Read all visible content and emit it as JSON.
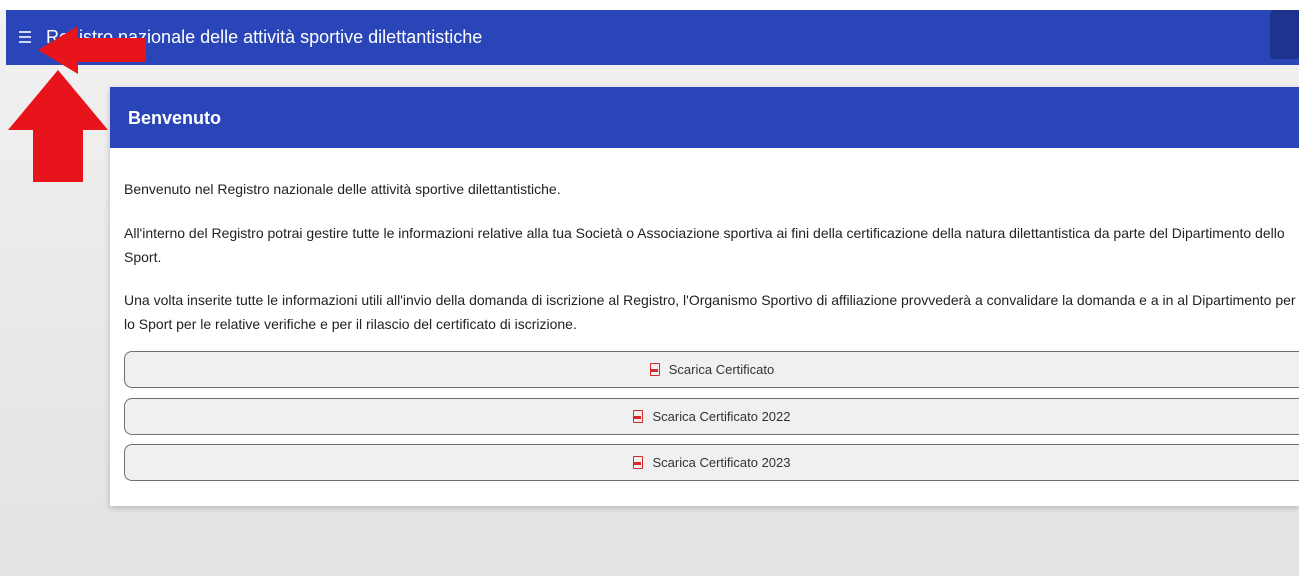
{
  "app_title": "Registro nazionale delle attività sportive dilettantistiche",
  "card": {
    "title": "Benvenuto",
    "paragraphs": [
      "Benvenuto nel Registro nazionale delle attività sportive dilettantistiche.",
      "All'interno del Registro potrai gestire tutte le informazioni relative alla tua Società o Associazione sportiva ai fini della certificazione della natura dilettantistica da parte del Dipartimento dello Sport.",
      "Una volta inserite tutte le informazioni utili all'invio della domanda di iscrizione al Registro, l'Organismo Sportivo di affiliazione provvederà a convalidare la domanda e a in al Dipartimento per lo Sport per le relative verifiche e per il rilascio del certificato di iscrizione."
    ],
    "buttons": [
      {
        "label": "Scarica Certificato",
        "icon": "pdf-icon"
      },
      {
        "label": "Scarica Certificato 2022",
        "icon": "pdf-icon"
      },
      {
        "label": "Scarica Certificato 2023",
        "icon": "pdf-icon"
      }
    ]
  },
  "colors": {
    "brand_blue": "#2a45b8",
    "annotation_red": "#e8141c",
    "pdf_icon_red": "#d62a2a"
  },
  "icons": {
    "menu": "hamburger-menu-icon",
    "annotations": [
      "red-arrow-left-icon",
      "red-arrow-up-icon"
    ]
  }
}
